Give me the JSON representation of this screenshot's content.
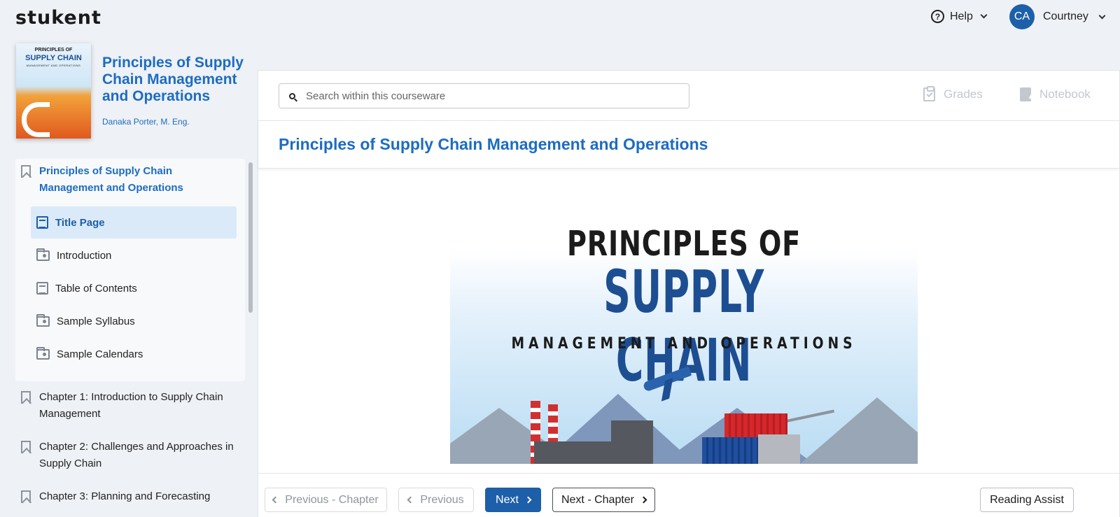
{
  "header": {
    "logo": "stukent",
    "help_label": "Help",
    "user_initials": "CA",
    "user_name": "Courtney"
  },
  "book": {
    "cover_line1": "PRINCIPLES OF",
    "cover_line2": "SUPPLY CHAIN",
    "cover_line3": "MANAGEMENT AND OPERATIONS",
    "title": "Principles of Supply Chain Management and Operations",
    "author": "Danaka Porter, M. Eng."
  },
  "sidebar": {
    "parent": "Principles of Supply Chain Management and Operations",
    "sub_items": [
      {
        "label": "Title Page",
        "icon": "page-icon",
        "active": true
      },
      {
        "label": "Introduction",
        "icon": "folder-icon"
      },
      {
        "label": "Table of Contents",
        "icon": "page-icon"
      },
      {
        "label": "Sample Syllabus",
        "icon": "folder-icon"
      },
      {
        "label": "Sample Calendars",
        "icon": "folder-icon"
      }
    ],
    "chapters": [
      {
        "label": "Chapter 1: Introduction to Supply Chain Management"
      },
      {
        "label": "Chapter 2: Challenges and Approaches in Supply Chain"
      },
      {
        "label": "Chapter 3: Planning and Forecasting"
      }
    ]
  },
  "toolbar": {
    "search_placeholder": "Search within this courseware",
    "grades_label": "Grades",
    "notebook_label": "Notebook"
  },
  "content": {
    "title": "Principles of Supply Chain Management and Operations",
    "cover_line1": "PRINCIPLES OF",
    "cover_line2": "SUPPLY CHAIN",
    "cover_line3": "MANAGEMENT AND OPERATIONS"
  },
  "navigation": {
    "prev_chapter": "Previous - Chapter",
    "previous": "Previous",
    "next": "Next",
    "next_chapter": "Next - Chapter",
    "reading_assist": "Reading Assist"
  },
  "colors": {
    "brand_blue": "#1d6cc1",
    "primary_button": "#1d5fa8",
    "active_item_bg": "#dbeaf8"
  }
}
